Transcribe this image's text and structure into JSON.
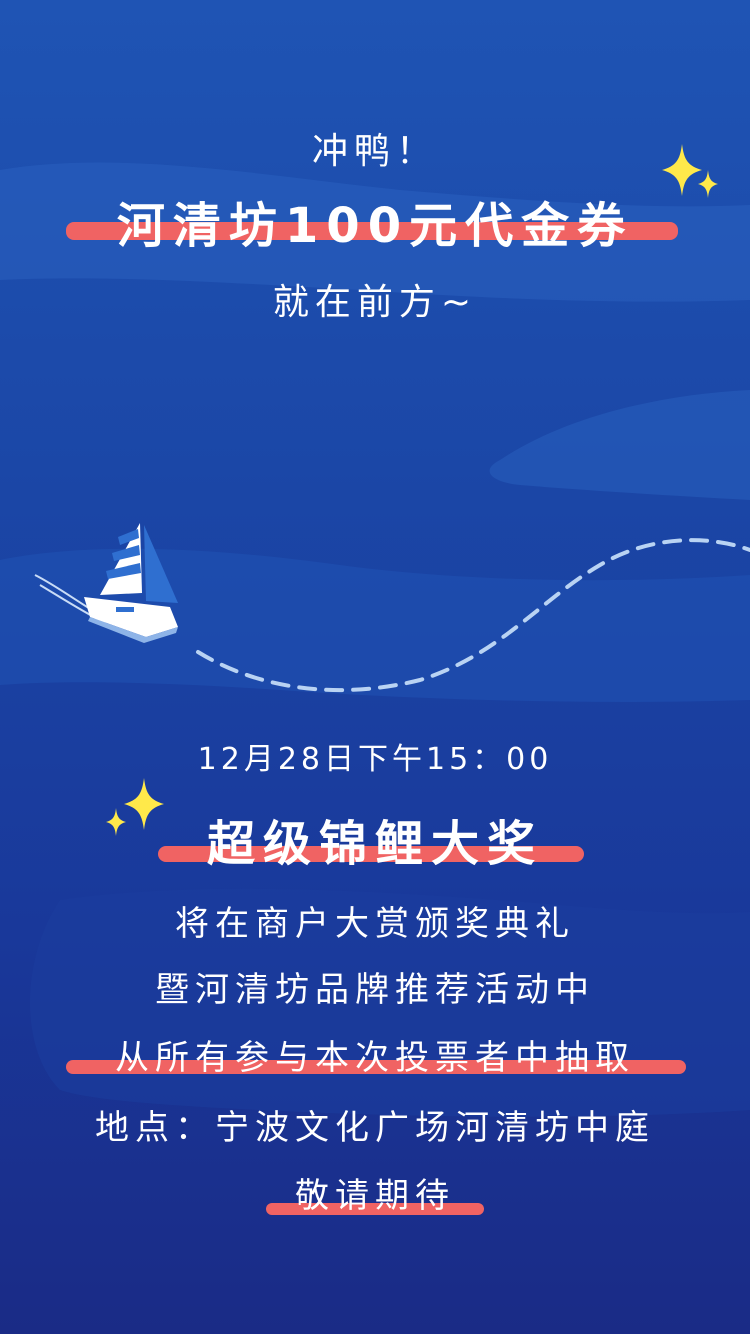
{
  "top": {
    "line1": "冲鸭！",
    "line2": "河清坊100元代金券",
    "line3": "就在前方~"
  },
  "event": {
    "date": "12月28日下午15：00",
    "prize": "超级锦鲤大奖",
    "line1": "将在商户大赏颁奖典礼",
    "line2": "暨河清坊品牌推荐活动中",
    "line3": "从所有参与本次投票者中抽取",
    "location": "地点：宁波文化广场河清坊中庭",
    "closing": "敬请期待"
  },
  "colors": {
    "background_top": "#1f54b4",
    "background_bottom": "#1a2b86",
    "highlight": "#f06363",
    "sparkle": "#ffe94a",
    "text": "#ffffff"
  },
  "icons": [
    "sailboat-icon",
    "sparkle-icon",
    "dashed-route"
  ]
}
